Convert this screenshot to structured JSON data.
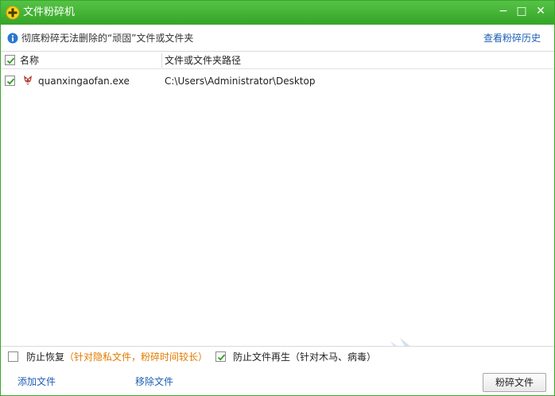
{
  "window": {
    "title": "文件粉碎机",
    "controls": {
      "minimize": "−",
      "maximize": "□",
      "close": "✕"
    }
  },
  "infobar": {
    "message": "彻底粉碎无法删除的“顽固”文件或文件夹",
    "history_link": "查看粉碎历史"
  },
  "table": {
    "columns": {
      "name": "名称",
      "path": "文件或文件夹路径"
    },
    "select_all_checked": true,
    "rows": [
      {
        "checked": true,
        "name": "quanxingaofan.exe",
        "path": "C:\\Users\\Administrator\\Desktop"
      }
    ]
  },
  "options": {
    "prevent_recovery": {
      "label": "防止恢复",
      "note": "（针对隐私文件，粉碎时间较长）",
      "checked": false
    },
    "prevent_regeneration": {
      "label": "防止文件再生",
      "note": "（针对木马、病毒）",
      "checked": true
    }
  },
  "bottom": {
    "add_file": "添加文件",
    "remove_file": "移除文件",
    "shred_button": "粉碎文件"
  },
  "watermark": {
    "text": "我爱IT技术网",
    "url": "www.52ij.com"
  },
  "colors": {
    "title_bar": "#3fb02f",
    "link": "#1e5fb4",
    "note": "#e07b00",
    "check": "#2f9a1f"
  }
}
